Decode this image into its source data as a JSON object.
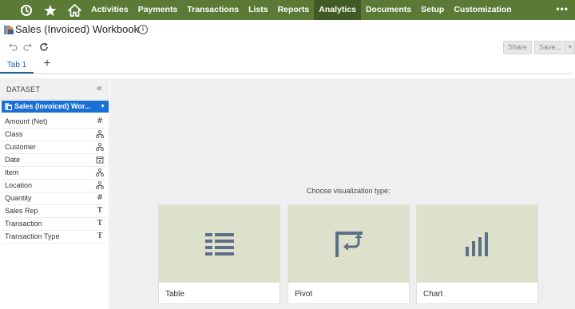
{
  "nav": {
    "items": [
      {
        "label": "Activities",
        "active": false
      },
      {
        "label": "Payments",
        "active": false
      },
      {
        "label": "Transactions",
        "active": false
      },
      {
        "label": "Lists",
        "active": false
      },
      {
        "label": "Reports",
        "active": false
      },
      {
        "label": "Analytics",
        "active": true
      },
      {
        "label": "Documents",
        "active": false
      },
      {
        "label": "Setup",
        "active": false
      },
      {
        "label": "Customization",
        "active": false
      }
    ],
    "more": "•••",
    "icons": [
      "recent-records-icon",
      "star-icon",
      "home-icon"
    ]
  },
  "header": {
    "title": "Sales (Invoiced) Workbook",
    "info": "i",
    "share_label": "Share",
    "save_label": "Save...",
    "save_arrow": "▼"
  },
  "tabs": {
    "items": [
      {
        "label": "Tab 1"
      }
    ],
    "add_label": "+"
  },
  "sidebar": {
    "title": "DATASET",
    "collapse": "«",
    "dataset": "Sales (Invoiced) Wor...",
    "dataset_caret": "▼",
    "fields": [
      {
        "label": "Amount (Net)",
        "type": "#"
      },
      {
        "label": "Class",
        "type": "hierarchy"
      },
      {
        "label": "Customer",
        "type": "hierarchy"
      },
      {
        "label": "Date",
        "type": "date"
      },
      {
        "label": "Item",
        "type": "hierarchy"
      },
      {
        "label": "Location",
        "type": "hierarchy"
      },
      {
        "label": "Quantity",
        "type": "#"
      },
      {
        "label": "Sales Rep",
        "type": "T"
      },
      {
        "label": "Transaction",
        "type": "T"
      },
      {
        "label": "Transaction Type",
        "type": "T"
      }
    ]
  },
  "main": {
    "prompt": "Choose visualization type:",
    "cards": [
      {
        "label": "Table",
        "icon": "table-icon"
      },
      {
        "label": "Pivot",
        "icon": "pivot-icon"
      },
      {
        "label": "Chart",
        "icon": "bar-chart-icon"
      }
    ]
  },
  "colors": {
    "nav_bg": "#5a7a35",
    "nav_active": "#3f5a23",
    "accent_blue": "#1a6fd4",
    "card_art": "#dde1cc",
    "icon_slate": "#5c6f87"
  }
}
